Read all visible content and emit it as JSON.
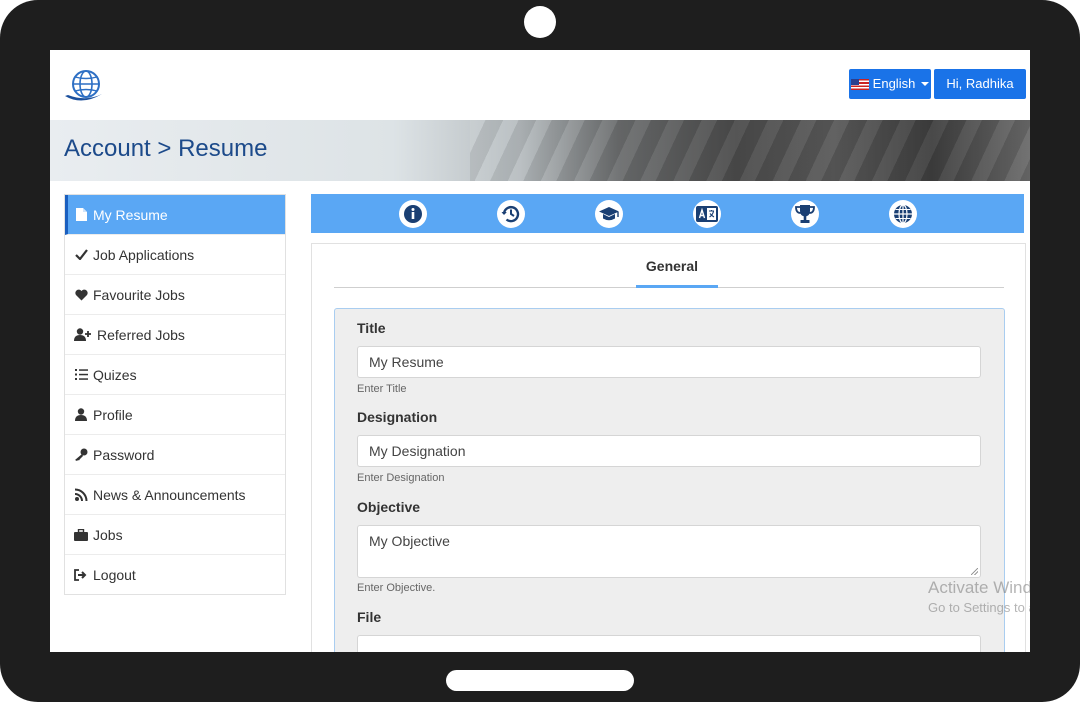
{
  "header": {
    "language_label": "English",
    "user_label": "Hi, Radhika"
  },
  "banner": {
    "title": "Account > Resume"
  },
  "sidebar": {
    "items": [
      {
        "label": "My Resume",
        "icon": "file-icon",
        "active": true
      },
      {
        "label": "Job Applications",
        "icon": "check-icon"
      },
      {
        "label": "Favourite Jobs",
        "icon": "heart-icon"
      },
      {
        "label": "Referred Jobs",
        "icon": "user-plus-icon"
      },
      {
        "label": "Quizes",
        "icon": "list-icon"
      },
      {
        "label": "Profile",
        "icon": "user-icon"
      },
      {
        "label": "Password",
        "icon": "key-icon"
      },
      {
        "label": "News & Announcements",
        "icon": "rss-icon"
      },
      {
        "label": "Jobs",
        "icon": "briefcase-icon"
      },
      {
        "label": "Logout",
        "icon": "logout-icon"
      }
    ]
  },
  "tabs": {
    "icons": [
      "info-icon",
      "history-icon",
      "graduation-cap-icon",
      "language-icon",
      "trophy-icon",
      "globe-icon"
    ],
    "active_subtab": "General"
  },
  "form": {
    "title_label": "Title",
    "title_value": "My Resume",
    "title_help": "Enter Title",
    "designation_label": "Designation",
    "designation_value": "My Designation",
    "designation_help": "Enter Designation",
    "objective_label": "Objective",
    "objective_value": "My Objective",
    "objective_help": "Enter Objective.",
    "file_label": "File"
  },
  "watermark": {
    "line1": "Activate Windows",
    "line2": "Go to Settings to activate Windows."
  },
  "colors": {
    "accent": "#5aa7f4",
    "button_blue": "#1a73e8",
    "title_blue": "#1c4a8a"
  }
}
